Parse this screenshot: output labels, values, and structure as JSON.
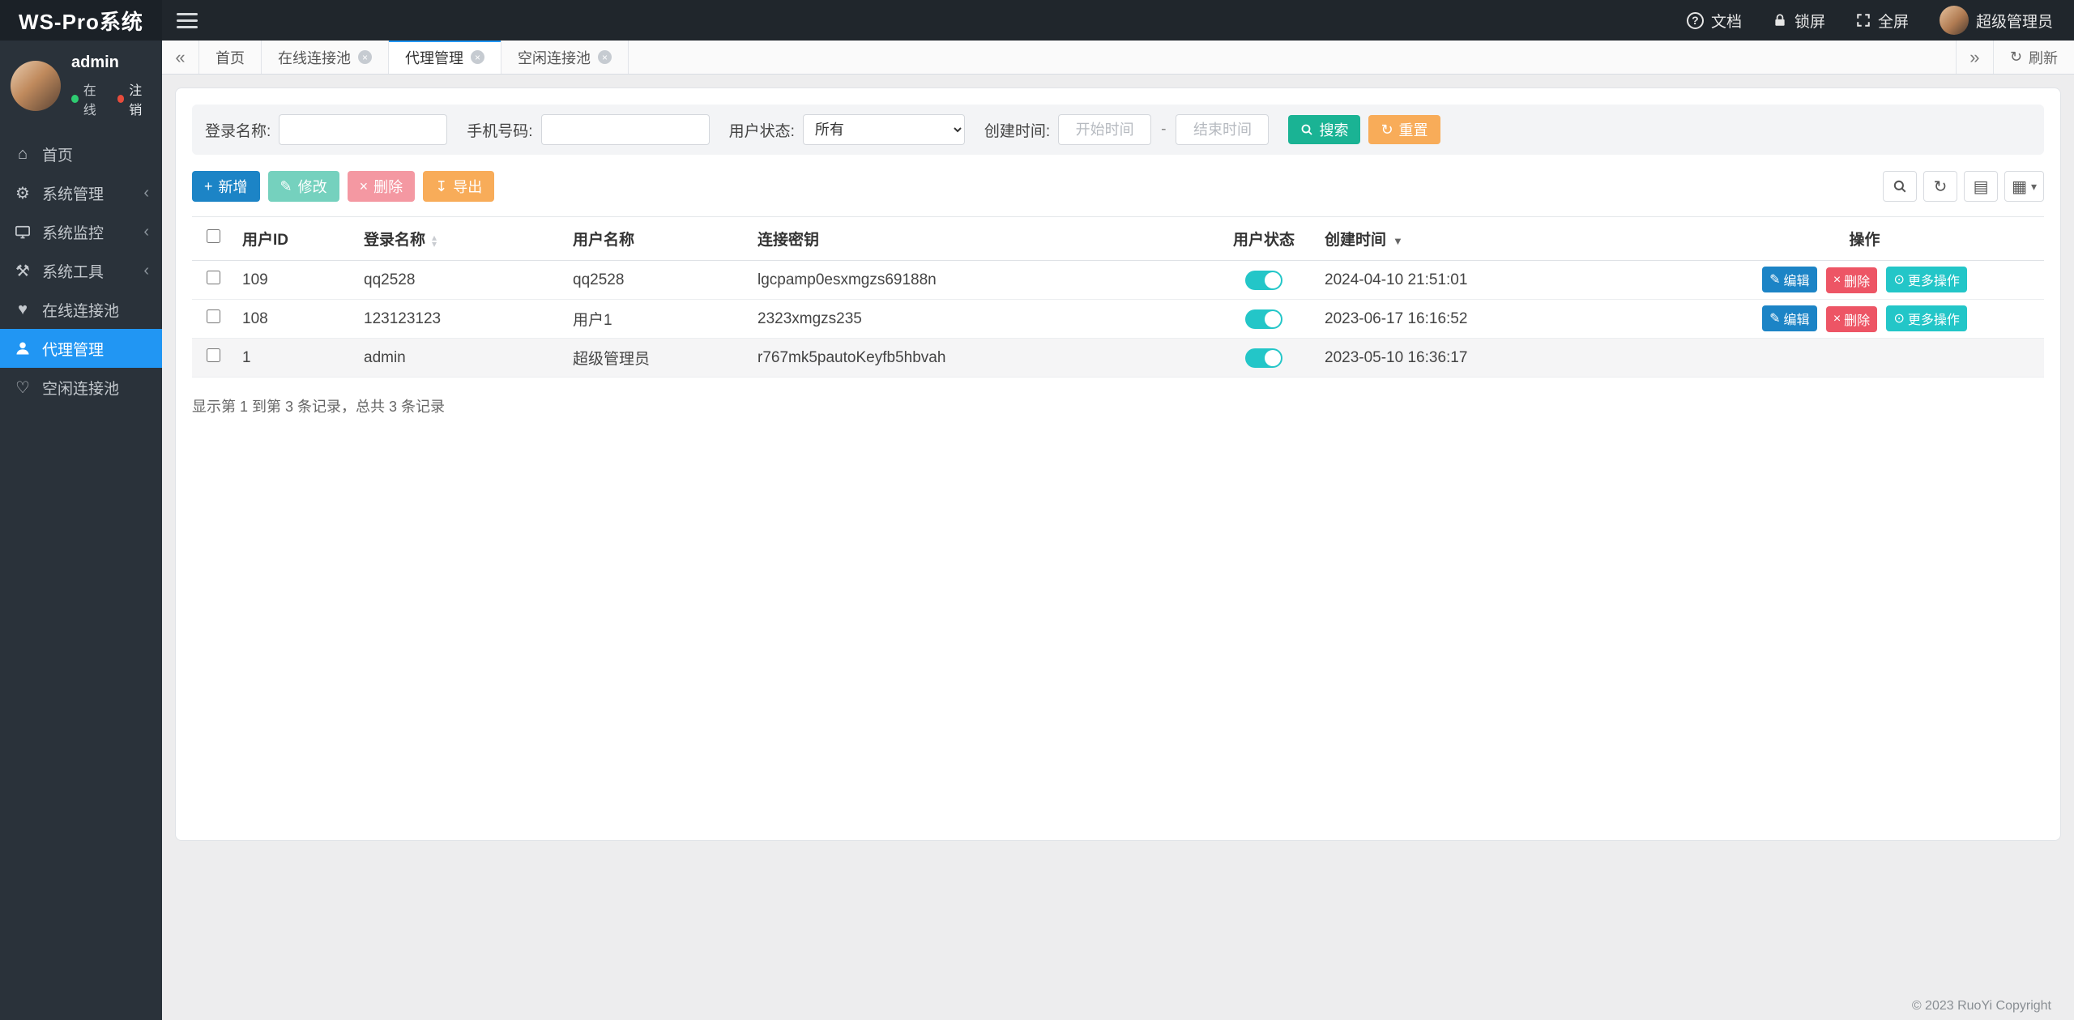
{
  "app": {
    "title": "WS-Pro系统"
  },
  "header": {
    "docs": "文档",
    "lock": "锁屏",
    "fullscreen": "全屏",
    "user": "超级管理员"
  },
  "sidebar": {
    "profile": {
      "name": "admin",
      "online": "在线",
      "logout": "注销"
    },
    "items": [
      {
        "label": "首页"
      },
      {
        "label": "系统管理"
      },
      {
        "label": "系统监控"
      },
      {
        "label": "系统工具"
      },
      {
        "label": "在线连接池"
      },
      {
        "label": "代理管理"
      },
      {
        "label": "空闲连接池"
      }
    ]
  },
  "tabbar": {
    "tabs": [
      {
        "label": "首页"
      },
      {
        "label": "在线连接池"
      },
      {
        "label": "代理管理"
      },
      {
        "label": "空闲连接池"
      }
    ],
    "refresh": "刷新"
  },
  "filters": {
    "login_name_label": "登录名称:",
    "phone_label": "手机号码:",
    "status_label": "用户状态:",
    "status_value": "所有",
    "created_label": "创建时间:",
    "start_placeholder": "开始时间",
    "range_separator": "-",
    "end_placeholder": "结束时间",
    "search": "搜索",
    "reset": "重置"
  },
  "toolbar": {
    "add": "新增",
    "edit": "修改",
    "remove": "删除",
    "export": "导出"
  },
  "table": {
    "headers": {
      "id": "用户ID",
      "login": "登录名称",
      "name": "用户名称",
      "key": "连接密钥",
      "status": "用户状态",
      "created": "创建时间",
      "actions": "操作"
    },
    "rows": [
      {
        "id": "109",
        "login": "qq2528",
        "name": "qq2528",
        "key": "lgcpamp0esxmgzs69188n",
        "created": "2024-04-10 21:51:01"
      },
      {
        "id": "108",
        "login": "123123123",
        "name": "用户1",
        "key": "2323xmgzs235",
        "created": "2023-06-17 16:16:52"
      },
      {
        "id": "1",
        "login": "admin",
        "name": "超级管理员",
        "key": "r767mk5pautoKeyfb5hbvah",
        "created": "2023-05-10 16:36:17"
      }
    ],
    "row_actions": {
      "edit": "编辑",
      "remove": "删除",
      "more": "更多操作"
    },
    "summary": "显示第 1 到第 3 条记录，总共 3 条记录"
  },
  "footer": {
    "copyright": "© 2023 RuoYi Copyright"
  },
  "colors": {
    "accent_blue": "#2196f3",
    "primary_green": "#1ab394",
    "warning_orange": "#f8ac59",
    "danger_red": "#ed5565",
    "info_teal": "#23c6c8",
    "edit_blue": "#1c84c6"
  }
}
